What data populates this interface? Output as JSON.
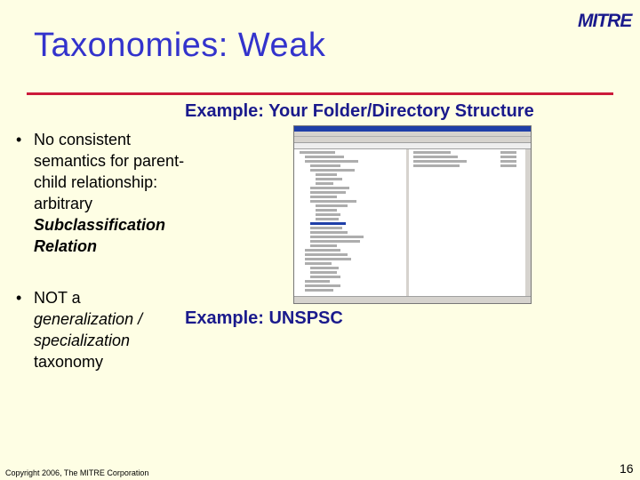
{
  "slide": {
    "title": "Taxonomies: Weak",
    "logo": "MITRE",
    "example1": "Example: Your Folder/Directory Structure",
    "example2": "Example: UNSPSC",
    "bullets": [
      {
        "marker": "•",
        "text_plain": "No consistent semantics for parent-child relationship: arbitrary",
        "text_emph": "Subclassification Relation"
      },
      {
        "marker": "•",
        "text_plain": "NOT a",
        "text_emph": "generalization / specialization",
        "text_tail": "taxonomy"
      }
    ],
    "copyright": "Copyright 2006, The MITRE Corporation",
    "page_number": "16"
  },
  "colors": {
    "background": "#fefee4",
    "title": "#3333cc",
    "rule": "#cc1a3a",
    "example_text": "#1a1a8c"
  },
  "screenshot": {
    "description_icon": "file-explorer-window"
  }
}
